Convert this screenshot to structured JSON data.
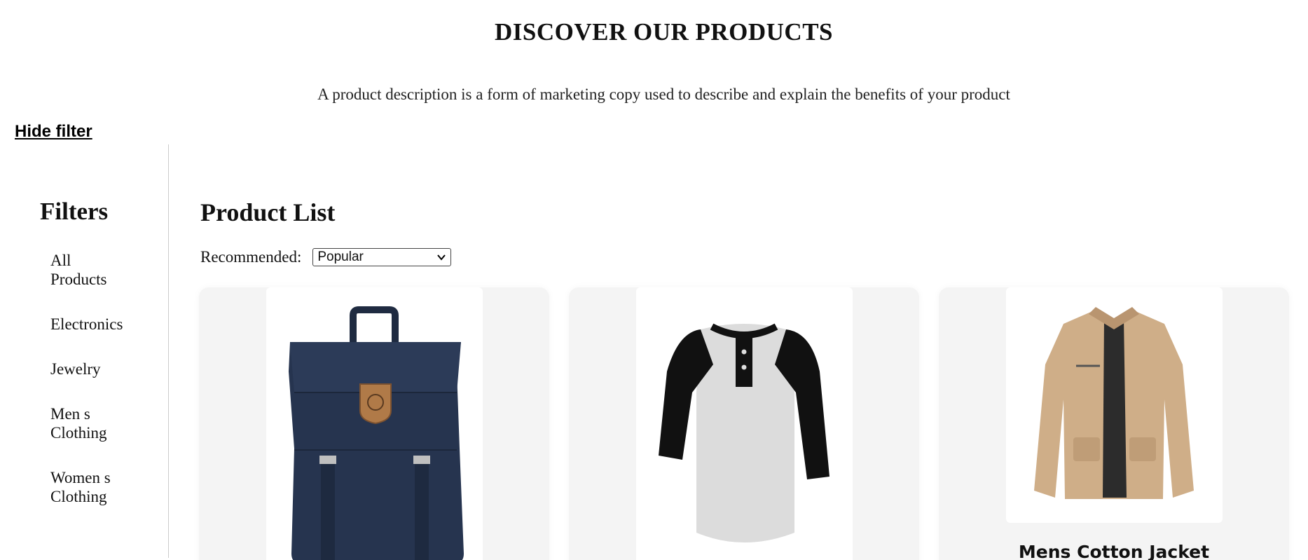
{
  "header": {
    "title": "DISCOVER OUR PRODUCTS",
    "subtitle": "A product description is a form of marketing copy used to describe and explain the benefits of your product"
  },
  "filter_toggle": "Hide filter",
  "sidebar": {
    "title": "Filters",
    "items": [
      {
        "label": "All Products"
      },
      {
        "label": "Electronics"
      },
      {
        "label": "Jewelry"
      },
      {
        "label": "Men s Clothing"
      },
      {
        "label": "Women s Clothing"
      }
    ]
  },
  "main": {
    "title": "Product List",
    "sort": {
      "label": "Recommended:",
      "selected": "Popular"
    },
    "products": [
      {
        "name": "",
        "image": "backpack-icon"
      },
      {
        "name": "",
        "image": "raglan-shirt-icon"
      },
      {
        "name": "Mens Cotton Jacket",
        "image": "jacket-icon"
      }
    ]
  },
  "colors": {
    "card_bg": "#f4f4f4",
    "backpack": "#26344f",
    "patch": "#b07a48",
    "shirt_body": "#dcdcdc",
    "shirt_sleeves": "#111111",
    "jacket": "#cfae88"
  }
}
